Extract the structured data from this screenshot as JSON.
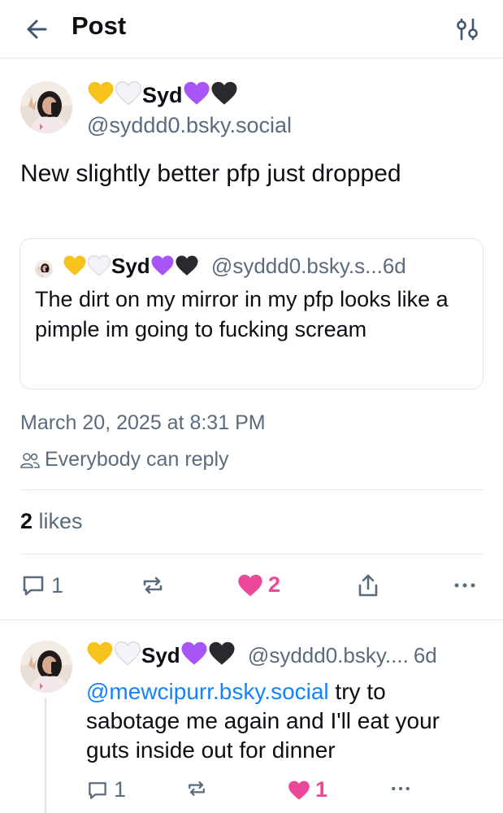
{
  "header": {
    "title": "Post",
    "back_icon": "arrow-left-icon",
    "filter_icon": "sliders-icon"
  },
  "post": {
    "author_name": "Syd",
    "author_handle": "@syddd0.bsky.social",
    "text": "New slightly better pfp just dropped",
    "quote": {
      "author_name": "Syd",
      "author_handle": "@syddd0.bsky.s...",
      "time": "6d",
      "text": "The dirt on my mirror in my pfp looks like a pimple im going to fucking scream"
    },
    "date": "March 20, 2025 at 8:31 PM",
    "reply_permission": "Everybody can reply",
    "likes_count": "2",
    "likes_label": "likes",
    "actions": {
      "reply_count": "1",
      "repost_count": "",
      "like_count": "2"
    }
  },
  "reply": {
    "author_name": "Syd",
    "author_handle": "@syddd0.bsky....",
    "time": "6d",
    "mention": "@mewcipurr.bsky.social",
    "text": " try to sabotage me again and I'll eat your guts inside out for dinner",
    "actions": {
      "reply_count": "1",
      "like_count": "1"
    }
  },
  "colors": {
    "accent_blue": "#1083fe",
    "like_pink": "#ec4899",
    "muted": "#5a6b7e",
    "border": "#e6e9ec"
  }
}
